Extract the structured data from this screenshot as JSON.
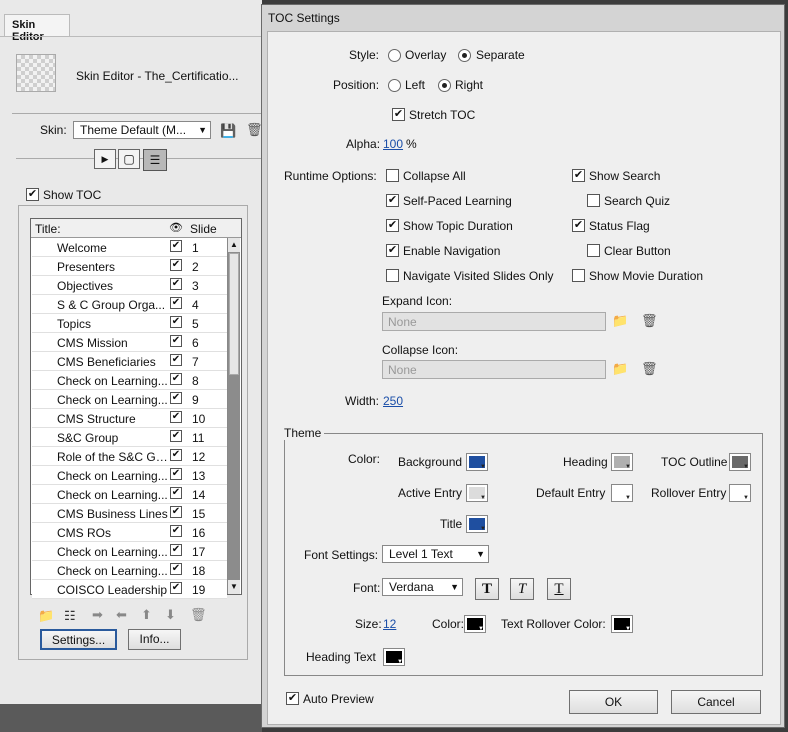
{
  "skin_panel": {
    "tab": "Skin Editor",
    "title": "Skin Editor - The_Certificatio...",
    "skin_label": "Skin:",
    "skin_value": "Theme Default (M...",
    "show_toc_label": "Show TOC",
    "table_headers": {
      "title": "Title:",
      "slide": "Slide"
    },
    "rows": [
      {
        "title": "Welcome",
        "slide": "1"
      },
      {
        "title": "Presenters",
        "slide": "2"
      },
      {
        "title": "Objectives",
        "slide": "3"
      },
      {
        "title": "S & C Group Orga...",
        "slide": "4"
      },
      {
        "title": "Topics",
        "slide": "5"
      },
      {
        "title": "CMS Mission",
        "slide": "6"
      },
      {
        "title": "CMS Beneficiaries",
        "slide": "7"
      },
      {
        "title": "Check on Learning...",
        "slide": "8"
      },
      {
        "title": "Check on Learning...",
        "slide": "9"
      },
      {
        "title": "CMS Structure",
        "slide": "10"
      },
      {
        "title": "S&C Group",
        "slide": "11"
      },
      {
        "title": "Role of the S&C Gr...",
        "slide": "12"
      },
      {
        "title": "Check on Learning...",
        "slide": "13"
      },
      {
        "title": "Check on Learning...",
        "slide": "14"
      },
      {
        "title": "CMS Business Lines",
        "slide": "15"
      },
      {
        "title": "CMS ROs",
        "slide": "16"
      },
      {
        "title": "Check on Learning...",
        "slide": "17"
      },
      {
        "title": "Check on Learning...",
        "slide": "18"
      },
      {
        "title": "COISCO Leadership",
        "slide": "19"
      }
    ],
    "settings_button": "Settings...",
    "info_button": "Info..."
  },
  "dialog": {
    "title": "TOC Settings",
    "style_label": "Style:",
    "style_overlay": "Overlay",
    "style_separate": "Separate",
    "position_label": "Position:",
    "position_left": "Left",
    "position_right": "Right",
    "stretch_toc": "Stretch TOC",
    "alpha_label": "Alpha:",
    "alpha_value": "100",
    "alpha_unit": "%",
    "runtime_label": "Runtime Options:",
    "options": {
      "collapse_all": "Collapse All",
      "show_search": "Show Search",
      "self_paced": "Self-Paced Learning",
      "search_quiz": "Search Quiz",
      "show_topic_duration": "Show Topic Duration",
      "status_flag": "Status Flag",
      "enable_navigation": "Enable Navigation",
      "clear_button": "Clear Button",
      "navigate_visited": "Navigate Visited Slides Only",
      "show_movie_duration": "Show Movie Duration"
    },
    "expand_icon_label": "Expand Icon:",
    "expand_icon_value": "None",
    "collapse_icon_label": "Collapse Icon:",
    "collapse_icon_value": "None",
    "width_label": "Width:",
    "width_value": "250",
    "theme_legend": "Theme",
    "color_label": "Color:",
    "background": "Background",
    "heading": "Heading",
    "toc_outline": "TOC Outline",
    "active_entry": "Active Entry",
    "default_entry": "Default Entry",
    "rollover_entry": "Rollover Entry",
    "title_label": "Title",
    "font_settings_label": "Font Settings:",
    "font_settings_value": "Level 1 Text",
    "font_label": "Font:",
    "font_value": "Verdana",
    "size_label": "Size:",
    "size_value": "12",
    "color2_label": "Color:",
    "text_rollover_label": "Text Rollover Color:",
    "heading_text_label": "Heading Text",
    "auto_preview": "Auto Preview",
    "ok": "OK",
    "cancel": "Cancel"
  },
  "colors": {
    "background": "#1f4fa0",
    "heading": "#b0b0b0",
    "toc_outline": "#6a6a6a",
    "active_entry": "#dcdcdc",
    "default_entry": "#ffffff",
    "rollover_entry": "#ffffff",
    "title": "#1f4fa0",
    "text": "#000000",
    "rollover": "#000000",
    "heading_text": "#000000"
  }
}
